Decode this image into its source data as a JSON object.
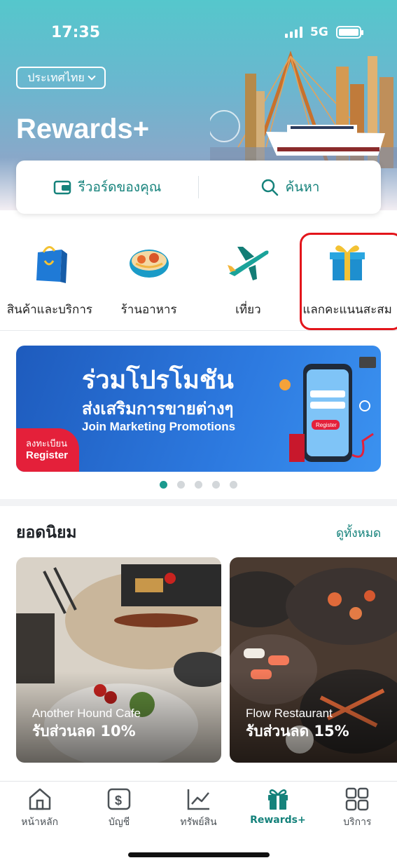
{
  "status_bar": {
    "time": "17:35",
    "network": "5G"
  },
  "header": {
    "country_label": "ประเทศไทย",
    "title": "Rewards+"
  },
  "actions": {
    "my_rewards": "รีวอร์ดของคุณ",
    "search": "ค้นหา"
  },
  "categories": [
    {
      "label": "สินค้าและบริการ",
      "icon": "shopping-bag-icon"
    },
    {
      "label": "ร้านอาหาร",
      "icon": "food-bowl-icon"
    },
    {
      "label": "เที่ยว",
      "icon": "airplane-icon"
    },
    {
      "label": "แลกคะแนนสะสม",
      "icon": "gift-box-icon",
      "highlighted": true
    }
  ],
  "banner": {
    "line1": "ร่วมโปรโมชัน",
    "line2": "ส่งเสริมการขายต่างๆ",
    "line3": "Join Marketing Promotions",
    "register_th": "ลงทะเบียน",
    "register_en": "Register",
    "phone_button": "Register",
    "pages": 5,
    "active_page": 1
  },
  "popular": {
    "title": "ยอดนิยม",
    "see_all": "ดูทั้งหมด",
    "items": [
      {
        "name": "Another Hound Cafe",
        "offer": "รับส่วนลด 10%"
      },
      {
        "name": "Flow Restaurant",
        "offer": "รับส่วนลด 15%"
      }
    ]
  },
  "bottom_nav": [
    {
      "label": "หน้าหลัก",
      "icon": "home-icon"
    },
    {
      "label": "บัญชี",
      "icon": "dollar-account-icon"
    },
    {
      "label": "ทรัพย์สิน",
      "icon": "chart-icon"
    },
    {
      "label": "Rewards+",
      "icon": "gift-icon",
      "active": true
    },
    {
      "label": "บริการ",
      "icon": "grid-icon"
    }
  ],
  "colors": {
    "accent": "#15827b",
    "highlight": "#e3151b",
    "banner_blue": "#1e5bbd"
  }
}
